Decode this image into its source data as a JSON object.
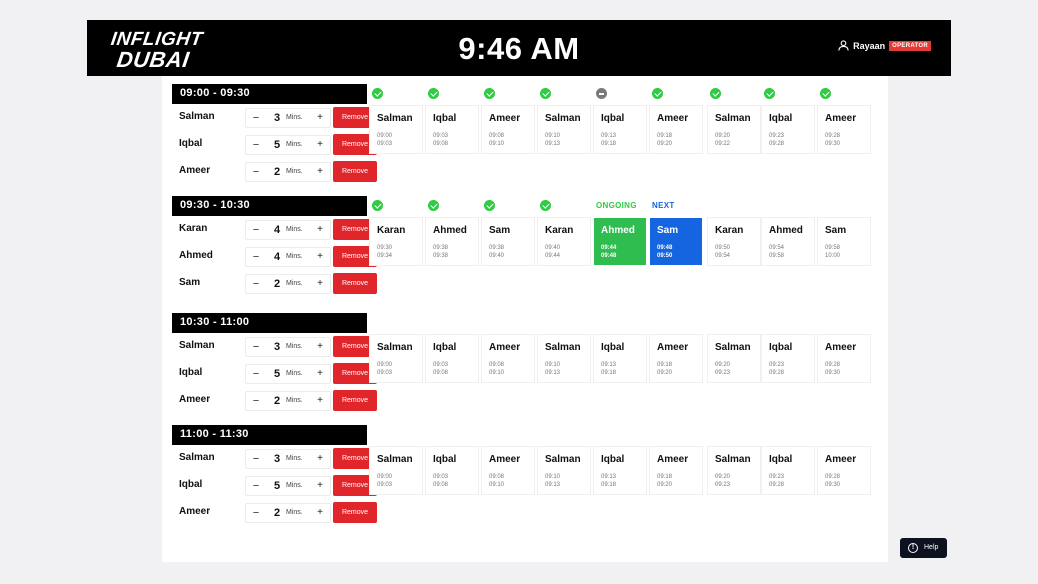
{
  "header": {
    "logo": {
      "line1": "INFLIGHT",
      "line2": "DUBAI"
    },
    "clock": "9:46 AM",
    "user": {
      "name": "Rayaan",
      "role": "OPERATOR"
    }
  },
  "labels": {
    "mins": "Mins.",
    "remove": "Remove",
    "decrement": "−",
    "increment": "+"
  },
  "status_labels": {
    "ongoing": "ONGOING",
    "next": "NEXT"
  },
  "slots": [
    {
      "time": "09:00  -  09:30",
      "participants": [
        {
          "name": "Salman",
          "mins": "3"
        },
        {
          "name": "Iqbal",
          "mins": "5"
        },
        {
          "name": "Ameer",
          "mins": "2"
        }
      ],
      "schedule": [
        {
          "name": "Salman",
          "start": "09:00",
          "end": "09:03",
          "status": "done"
        },
        {
          "name": "Iqbal",
          "start": "09:03",
          "end": "09:08",
          "status": "done"
        },
        {
          "name": "Ameer",
          "start": "09:08",
          "end": "09:10",
          "status": "done"
        },
        {
          "name": "Salman",
          "start": "09:10",
          "end": "09:13",
          "status": "done"
        },
        {
          "name": "Iqbal",
          "start": "09:13",
          "end": "09:18",
          "status": "skipped"
        },
        {
          "name": "Ameer",
          "start": "09:18",
          "end": "09:20",
          "status": "done"
        },
        {
          "name": "Salman",
          "start": "09:20",
          "end": "09:22",
          "status": "done"
        },
        {
          "name": "Iqbal",
          "start": "09:23",
          "end": "09:28",
          "status": "done"
        },
        {
          "name": "Ameer",
          "start": "09:28",
          "end": "09:30",
          "status": "done"
        }
      ]
    },
    {
      "time": "09:30  -  10:30",
      "participants": [
        {
          "name": "Karan",
          "mins": "4"
        },
        {
          "name": "Ahmed",
          "mins": "4"
        },
        {
          "name": "Sam",
          "mins": "2"
        }
      ],
      "schedule": [
        {
          "name": "Karan",
          "start": "09:30",
          "end": "09:34",
          "status": "done"
        },
        {
          "name": "Ahmed",
          "start": "09:38",
          "end": "09:38",
          "status": "done"
        },
        {
          "name": "Sam",
          "start": "09:38",
          "end": "09:40",
          "status": "done"
        },
        {
          "name": "Karan",
          "start": "09:40",
          "end": "09:44",
          "status": "done"
        },
        {
          "name": "Ahmed",
          "start": "09:44",
          "end": "09:48",
          "status": "ongoing"
        },
        {
          "name": "Sam",
          "start": "09:48",
          "end": "09:50",
          "status": "next"
        },
        {
          "name": "Karan",
          "start": "09:50",
          "end": "09:54",
          "status": ""
        },
        {
          "name": "Ahmed",
          "start": "09:54",
          "end": "09:58",
          "status": ""
        },
        {
          "name": "Sam",
          "start": "09:58",
          "end": "10:00",
          "status": ""
        }
      ]
    },
    {
      "time": "10:30  -  11:00",
      "participants": [
        {
          "name": "Salman",
          "mins": "3"
        },
        {
          "name": "Iqbal",
          "mins": "5"
        },
        {
          "name": "Ameer",
          "mins": "2"
        }
      ],
      "schedule": [
        {
          "name": "Salman",
          "start": "09:00",
          "end": "09:03",
          "status": ""
        },
        {
          "name": "Iqbal",
          "start": "09:03",
          "end": "09:08",
          "status": ""
        },
        {
          "name": "Ameer",
          "start": "09:08",
          "end": "09:10",
          "status": ""
        },
        {
          "name": "Salman",
          "start": "09:10",
          "end": "09:13",
          "status": ""
        },
        {
          "name": "Iqbal",
          "start": "09:13",
          "end": "09:18",
          "status": ""
        },
        {
          "name": "Ameer",
          "start": "09:18",
          "end": "09:20",
          "status": ""
        },
        {
          "name": "Salman",
          "start": "09:20",
          "end": "09:23",
          "status": ""
        },
        {
          "name": "Iqbal",
          "start": "09:23",
          "end": "09:28",
          "status": ""
        },
        {
          "name": "Ameer",
          "start": "09:28",
          "end": "09:30",
          "status": ""
        }
      ]
    },
    {
      "time": "11:00  -  11:30",
      "participants": [
        {
          "name": "Salman",
          "mins": "3"
        },
        {
          "name": "Iqbal",
          "mins": "5"
        },
        {
          "name": "Ameer",
          "mins": "2"
        }
      ],
      "schedule": [
        {
          "name": "Salman",
          "start": "09:00",
          "end": "09:03",
          "status": ""
        },
        {
          "name": "Iqbal",
          "start": "09:03",
          "end": "09:08",
          "status": ""
        },
        {
          "name": "Ameer",
          "start": "09:08",
          "end": "09:10",
          "status": ""
        },
        {
          "name": "Salman",
          "start": "09:10",
          "end": "09:13",
          "status": ""
        },
        {
          "name": "Iqbal",
          "start": "09:13",
          "end": "09:18",
          "status": ""
        },
        {
          "name": "Ameer",
          "start": "09:18",
          "end": "09:20",
          "status": ""
        },
        {
          "name": "Salman",
          "start": "09:20",
          "end": "09:23",
          "status": ""
        },
        {
          "name": "Iqbal",
          "start": "09:23",
          "end": "09:28",
          "status": ""
        },
        {
          "name": "Ameer",
          "start": "09:28",
          "end": "09:30",
          "status": ""
        }
      ]
    }
  ],
  "help": {
    "label": "Help",
    "icon": "!"
  }
}
